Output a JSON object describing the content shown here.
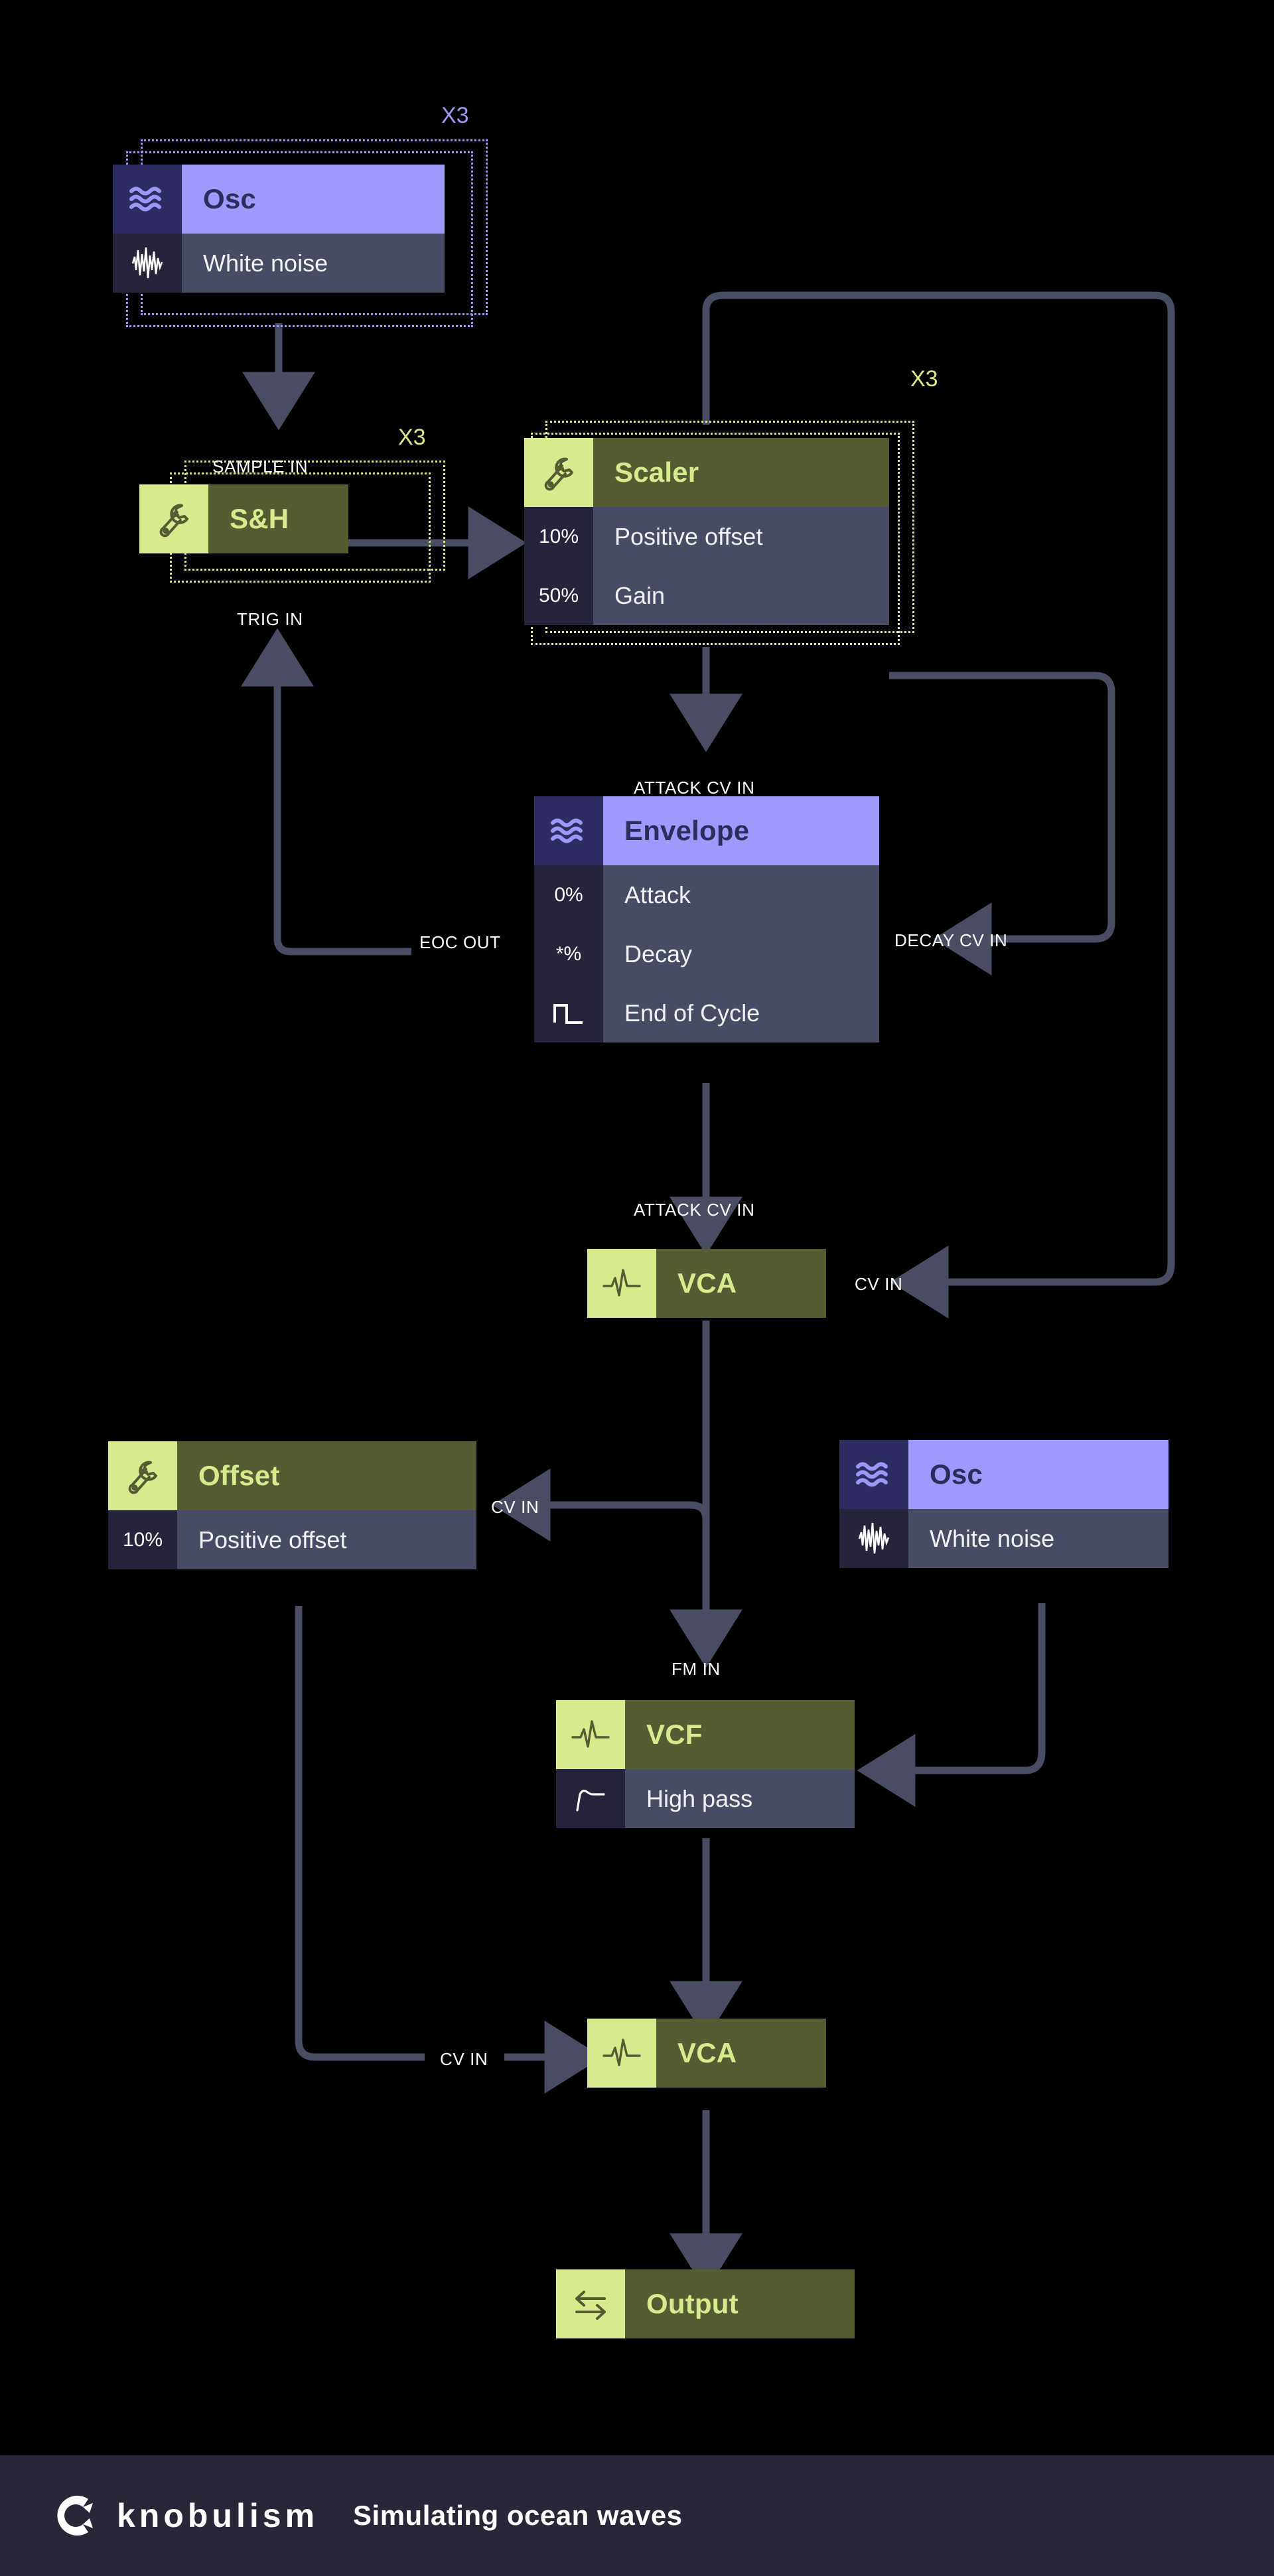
{
  "colors": {
    "background": "#000000",
    "wire": "#4a4c63",
    "tool_icon_bg": "#d7eb8e",
    "tool_title_bg": "#555c32",
    "tool_title_text": "#d7eb8e",
    "osc_icon_bg": "#2f2c63",
    "osc_title_bg": "#a099fb",
    "osc_title_text": "#2e2b5e",
    "row_value_bg": "#26243a",
    "row_label_bg": "#474b63",
    "ghost_green": "#d7eb8e",
    "ghost_purple": "#9d98f7",
    "footer_bg": "#272738"
  },
  "modules": [
    {
      "id": "osc-top",
      "theme": "osc",
      "icon": "waves-icon",
      "title": "Osc",
      "multiplier": "X3",
      "rows": [
        {
          "value": "",
          "value_icon": "noise-waveform-icon",
          "label": "White noise"
        }
      ]
    },
    {
      "id": "sample-and-hold",
      "theme": "tool",
      "icon": "wrench-icon",
      "title": "S&H",
      "multiplier": "X3",
      "rows": []
    },
    {
      "id": "scaler",
      "theme": "tool",
      "icon": "wrench-icon",
      "title": "Scaler",
      "multiplier": "X3",
      "rows": [
        {
          "value": "10%",
          "label": "Positive offset"
        },
        {
          "value": "50%",
          "label": "Gain"
        }
      ]
    },
    {
      "id": "envelope",
      "theme": "osc",
      "icon": "waves-icon",
      "title": "Envelope",
      "multiplier": "",
      "rows": [
        {
          "value": "0%",
          "label": "Attack"
        },
        {
          "value": "*%",
          "label": "Decay"
        },
        {
          "value": "",
          "value_icon": "pulse-gate-icon",
          "label": "End of Cycle"
        }
      ]
    },
    {
      "id": "vca-top",
      "theme": "tool",
      "icon": "spike-waveform-icon",
      "title": "VCA",
      "multiplier": "",
      "rows": []
    },
    {
      "id": "offset",
      "theme": "tool",
      "icon": "wrench-icon",
      "title": "Offset",
      "multiplier": "",
      "rows": [
        {
          "value": "10%",
          "label": "Positive offset"
        }
      ]
    },
    {
      "id": "osc-bottom",
      "theme": "osc",
      "icon": "waves-icon",
      "title": "Osc",
      "multiplier": "",
      "rows": [
        {
          "value": "",
          "value_icon": "noise-waveform-icon",
          "label": "White noise"
        }
      ]
    },
    {
      "id": "vcf",
      "theme": "tool",
      "icon": "spike-waveform-icon",
      "title": "VCF",
      "multiplier": "",
      "rows": [
        {
          "value": "",
          "value_icon": "high-pass-curve-icon",
          "label": "High pass"
        }
      ]
    },
    {
      "id": "vca-bottom",
      "theme": "tool",
      "icon": "spike-waveform-icon",
      "title": "VCA",
      "multiplier": "",
      "rows": []
    },
    {
      "id": "output",
      "theme": "tool",
      "icon": "exchange-arrows-icon",
      "title": "Output",
      "multiplier": "",
      "rows": []
    }
  ],
  "ports": [
    {
      "id": "sample-in",
      "label": "SAMPLE IN"
    },
    {
      "id": "trig-in",
      "label": "TRIG IN"
    },
    {
      "id": "attack-cv-in-env",
      "label": "ATTACK CV IN"
    },
    {
      "id": "eoc-out",
      "label": "EOC OUT"
    },
    {
      "id": "decay-cv-in",
      "label": "DECAY CV IN"
    },
    {
      "id": "attack-cv-in-vca",
      "label": "ATTACK CV IN"
    },
    {
      "id": "cv-in-vca-top",
      "label": "CV IN"
    },
    {
      "id": "cv-in-offset",
      "label": "CV IN"
    },
    {
      "id": "fm-in",
      "label": "FM IN"
    },
    {
      "id": "cv-in-vca-bottom",
      "label": "CV IN"
    }
  ],
  "footer": {
    "logo": "knobulism-logo-icon",
    "brand": "knobulism",
    "tagline": "Simulating ocean waves"
  }
}
